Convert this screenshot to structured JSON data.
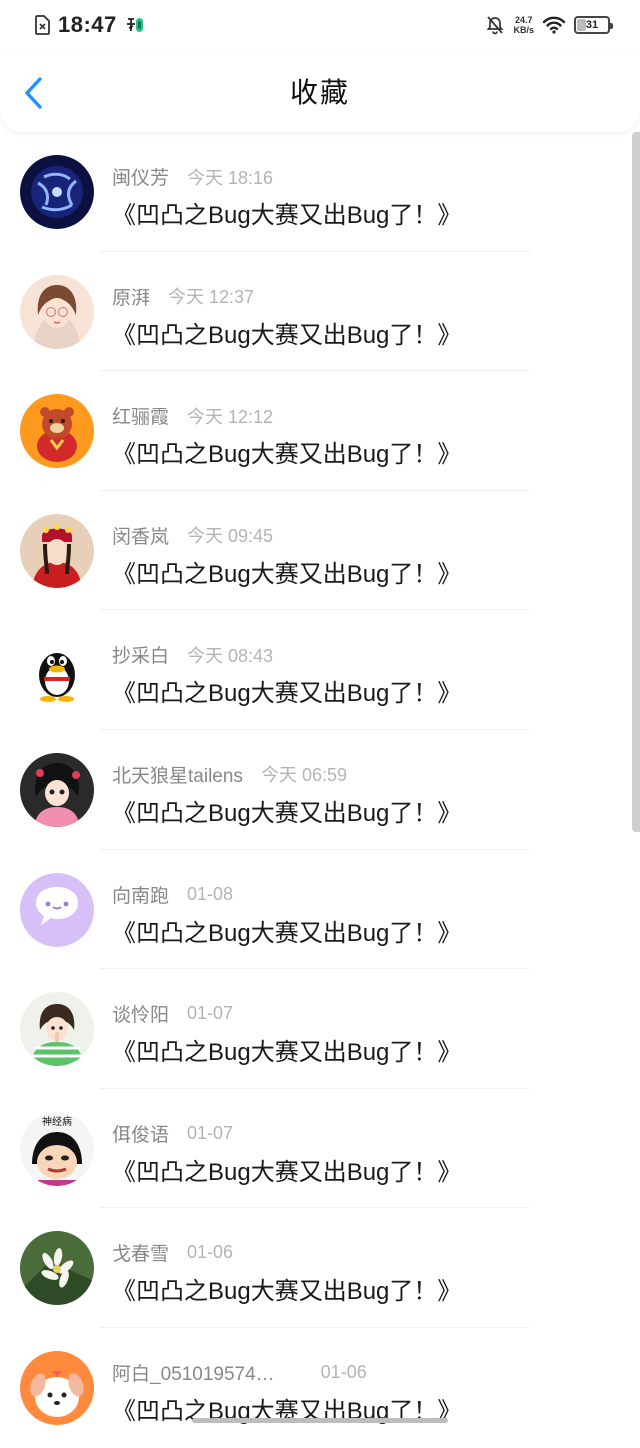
{
  "status_bar": {
    "time": "18:47",
    "net_speed_value": "24.7",
    "net_speed_unit": "KB/s",
    "battery_level": "31",
    "icons": [
      "sim-icon",
      "app-notification-icon",
      "mute-bell-icon",
      "wifi-icon",
      "battery-icon"
    ]
  },
  "header": {
    "title": "收藏",
    "back_icon": "chevron-left-icon",
    "accent_color": "#1e90ff"
  },
  "favorites": [
    {
      "name": "闽仪芳",
      "time": "今天 18:16",
      "title": "《凹凸之Bug大赛又出Bug了！》",
      "avatar": "blue-abstract-avatar"
    },
    {
      "name": "原湃",
      "time": "今天 12:37",
      "title": "《凹凸之Bug大赛又出Bug了！》",
      "avatar": "girl-glasses-avatar"
    },
    {
      "name": "红骊霞",
      "time": "今天 12:12",
      "title": "《凹凸之Bug大赛又出Bug了！》",
      "avatar": "cartoon-bear-avatar"
    },
    {
      "name": "闵香岚",
      "time": "今天 09:45",
      "title": "《凹凸之Bug大赛又出Bug了！》",
      "avatar": "opera-girl-avatar"
    },
    {
      "name": "抄采白",
      "time": "今天 08:43",
      "title": "《凹凸之Bug大赛又出Bug了！》",
      "avatar": "penguin-avatar"
    },
    {
      "name": "北天狼星tailens",
      "time": "今天 06:59",
      "title": "《凹凸之Bug大赛又出Bug了！》",
      "avatar": "cartoon-girl-avatar"
    },
    {
      "name": "向南跑",
      "time": "01-08",
      "title": "《凹凸之Bug大赛又出Bug了！》",
      "avatar": "purple-chat-avatar"
    },
    {
      "name": "谈怜阳",
      "time": "01-07",
      "title": "《凹凸之Bug大赛又出Bug了！》",
      "avatar": "green-shirt-girl-avatar"
    },
    {
      "name": "佴俊语",
      "time": "01-07",
      "title": "《凹凸之Bug大赛又出Bug了！》",
      "avatar": "meme-face-avatar",
      "avatar_caption": "神经病"
    },
    {
      "name": "戈春雪",
      "time": "01-06",
      "title": "《凹凸之Bug大赛又出Bug了！》",
      "avatar": "white-flowers-avatar"
    },
    {
      "name": "阿白_051019574…",
      "time": "01-06",
      "title": "《凹凸之Bug大赛又出Bug了！》",
      "avatar": "cartoon-dog-avatar"
    }
  ]
}
